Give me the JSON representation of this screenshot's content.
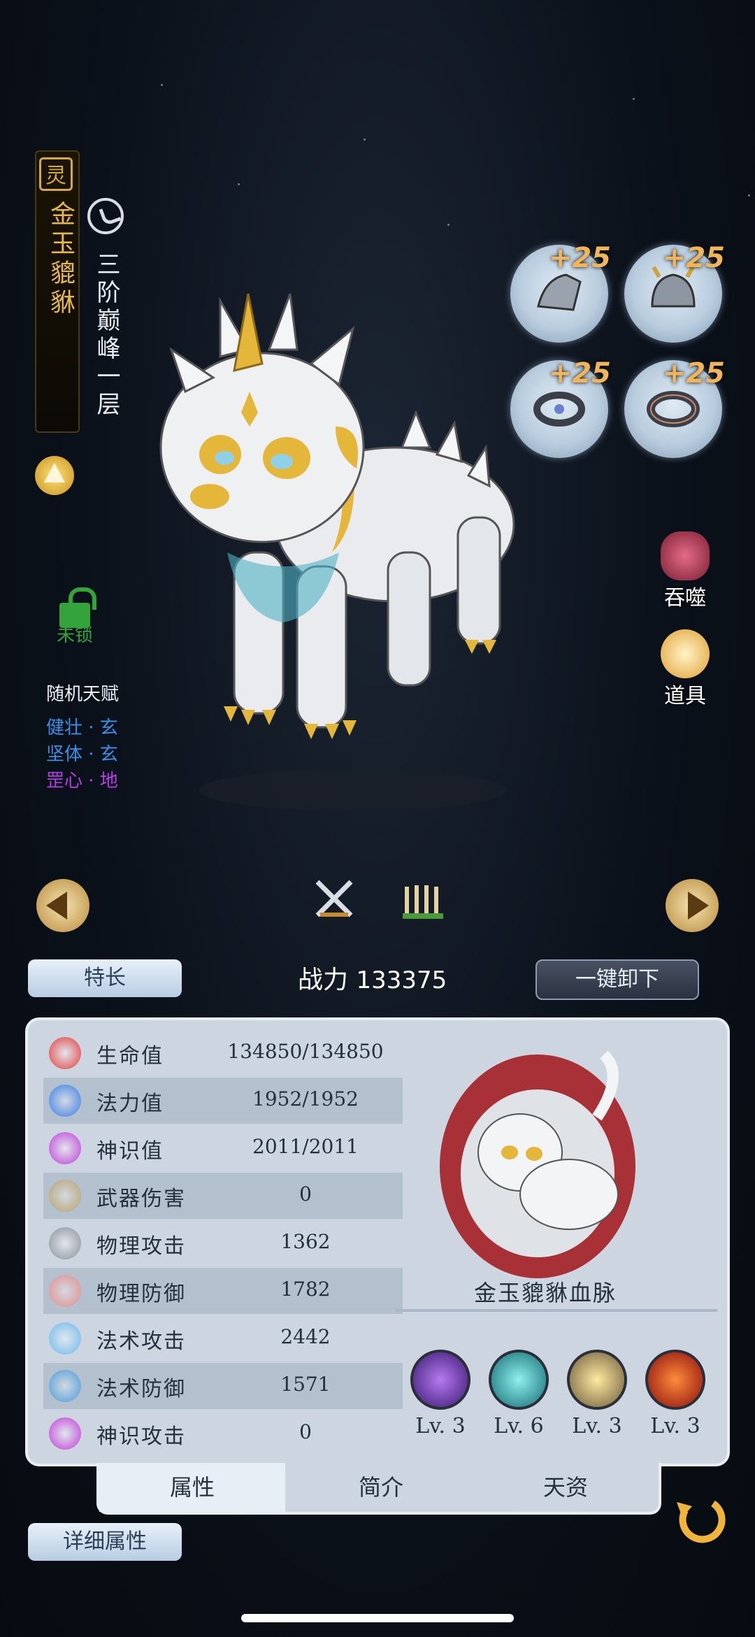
{
  "pet": {
    "name": "金玉貔貅",
    "seal_char": "灵",
    "rank": "三阶巅峰一层",
    "lock_label": "未锁"
  },
  "talents": {
    "title": "随机天赋",
    "items": [
      {
        "text": "健壮 · 玄",
        "color": "#3a8fe8"
      },
      {
        "text": "坚体 · 玄",
        "color": "#3a8fe8"
      },
      {
        "text": "罡心 · 地",
        "color": "#b43ee6"
      }
    ]
  },
  "equipment": [
    {
      "name": "armor-gauntlet",
      "plus": "+25"
    },
    {
      "name": "horned-helmet",
      "plus": "+25"
    },
    {
      "name": "gem-ring",
      "plus": "+25"
    },
    {
      "name": "band-ring",
      "plus": "+25"
    }
  ],
  "side_buttons": {
    "devour": "吞噬",
    "items": "道具"
  },
  "toolbar": {
    "specialty": "特长",
    "power_label": "战力",
    "power_value": "133375",
    "unequip_all": "一键卸下"
  },
  "stats": [
    {
      "icon": "heart-icon",
      "name": "生命值",
      "value": "134850/134850"
    },
    {
      "icon": "flame-icon",
      "name": "法力值",
      "value": "1952/1952"
    },
    {
      "icon": "swirl-icon",
      "name": "神识值",
      "value": "2011/2011"
    },
    {
      "icon": "dagger-icon",
      "name": "武器伤害",
      "value": "0"
    },
    {
      "icon": "sword-icon",
      "name": "物理攻击",
      "value": "1362"
    },
    {
      "icon": "shield-icon",
      "name": "物理防御",
      "value": "1782"
    },
    {
      "icon": "blue-sword-icon",
      "name": "法术攻击",
      "value": "2442"
    },
    {
      "icon": "blue-shield-icon",
      "name": "法术防御",
      "value": "1571"
    },
    {
      "icon": "swirl-icon",
      "name": "神识攻击",
      "value": "0"
    }
  ],
  "bloodline": {
    "name": "金玉貔貅血脉",
    "skills": [
      {
        "level": "Lv. 3",
        "color": "#5a2a9a"
      },
      {
        "level": "Lv. 6",
        "color": "#2a9aa0"
      },
      {
        "level": "Lv. 3",
        "color": "#c8a02a"
      },
      {
        "level": "Lv. 3",
        "color": "#c42a1a"
      }
    ]
  },
  "tabs": [
    {
      "label": "属性",
      "active": true
    },
    {
      "label": "简介",
      "active": false
    },
    {
      "label": "天资",
      "active": false
    }
  ],
  "detail_button": "详细属性",
  "colors": {
    "gold": "#e6b84a",
    "panel": "#cdd6e0",
    "row_alt": "#b3c0ce"
  }
}
